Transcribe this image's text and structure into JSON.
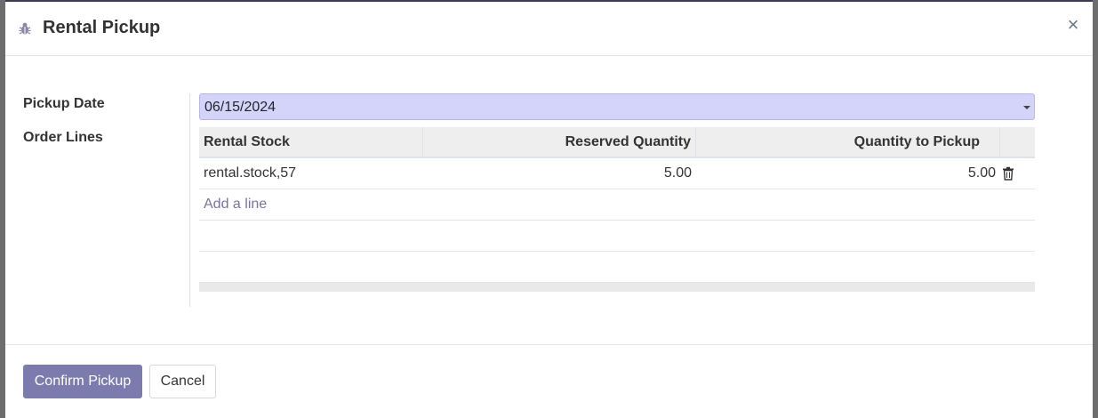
{
  "dialog": {
    "title": "Rental Pickup",
    "close_label": "×"
  },
  "form": {
    "pickup_date_label": "Pickup Date",
    "pickup_date_value": "06/15/2024",
    "order_lines_label": "Order Lines"
  },
  "table": {
    "columns": [
      "Rental Stock",
      "Reserved Quantity",
      "Quantity to Pickup"
    ],
    "rows": [
      {
        "rental_stock": "rental.stock,57",
        "reserved_quantity": "5.00",
        "quantity_to_pickup": "5.00"
      }
    ],
    "add_line_label": "Add a line"
  },
  "footer": {
    "confirm_label": "Confirm Pickup",
    "cancel_label": "Cancel"
  },
  "colors": {
    "primary": "#7c7bad",
    "date_field_bg": "#d4d4fb"
  },
  "icons": {
    "title_icon": "bug-icon",
    "row_action": "trash-icon",
    "dropdown": "caret-down-icon"
  }
}
